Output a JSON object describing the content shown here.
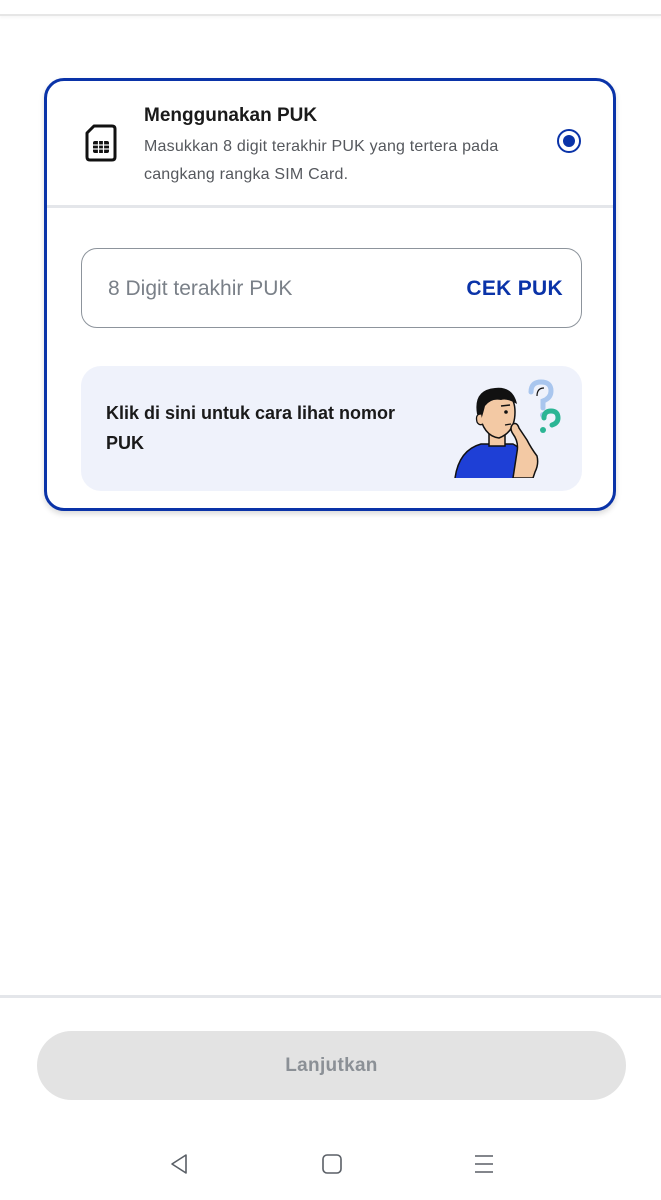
{
  "option": {
    "title": "Menggunakan PUK",
    "description": "Masukkan 8 digit terakhir PUK yang tertera pada cangkang rangka SIM Card.",
    "icon": "sim-card-icon",
    "selected": true
  },
  "puk_input": {
    "value": "",
    "placeholder": "8 Digit terakhir PUK",
    "action_label": "CEK PUK"
  },
  "help": {
    "text": "Klik di sini untuk cara lihat nomor PUK",
    "illustration": "thinking-person-illustration"
  },
  "footer": {
    "continue_label": "Lanjutkan",
    "continue_enabled": false
  },
  "nav": {
    "back_icon": "back-triangle-icon",
    "home_icon": "home-square-icon",
    "menu_icon": "menu-lines-icon"
  },
  "colors": {
    "accent": "#0a33a8",
    "banner_bg": "#eff2fb",
    "disabled_btn_bg": "#e3e3e3",
    "disabled_btn_text": "#8b9096",
    "divider": "#e4e6ea"
  }
}
